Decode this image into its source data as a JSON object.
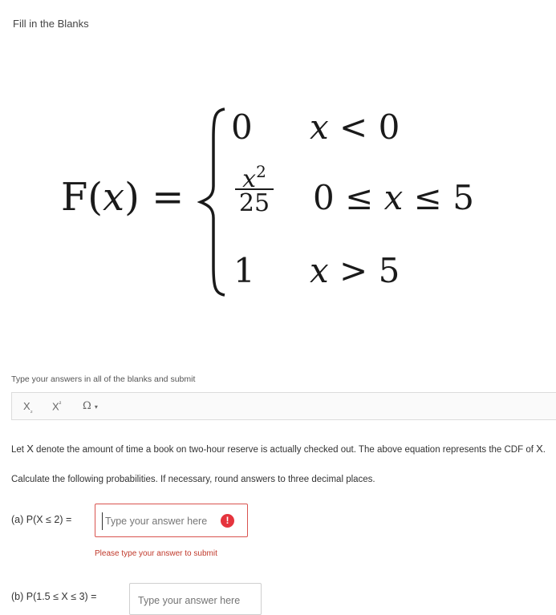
{
  "header": {
    "title": "Fill in the Blanks"
  },
  "formula": {
    "lhs_f": "F(",
    "lhs_x": "x",
    "lhs_close": ") =",
    "cases": [
      {
        "value": "0",
        "cond_var": "x",
        "cond": "< 0"
      },
      {
        "value_num": "x",
        "value_exp": "2",
        "value_den": "25",
        "cond_pre": "0 ≤ ",
        "cond_var": "x",
        "cond": " ≤ 5"
      },
      {
        "value": "1",
        "cond_var": "x",
        "cond": "> 5"
      }
    ]
  },
  "hint": "Type your answers in all of the blanks and submit",
  "toolbar": {
    "subscript": "X",
    "subscript_mark": "₂",
    "superscript": "X",
    "superscript_mark": "²",
    "symbols": "Ω",
    "symbols_caret": "▾"
  },
  "problem": {
    "text_pre": "Let ",
    "text_var": "X",
    "text_mid": " denote the amount of time a book on two-hour reserve is actually checked out. The above equation represents the CDF of ",
    "text_var2": "X",
    "text_end": ".",
    "instruction": "Calculate the following probabilities. If necessary, round answers to three decimal places."
  },
  "questions": [
    {
      "label": "(a) P(X ≤ 2) =",
      "placeholder": "Type your answer here",
      "value": "",
      "error_icon": "!",
      "error": "Please type your answer to submit"
    },
    {
      "label": "(b) P(1.5 ≤ X ≤ 3) =",
      "placeholder": "Type your answer here",
      "value": ""
    }
  ]
}
